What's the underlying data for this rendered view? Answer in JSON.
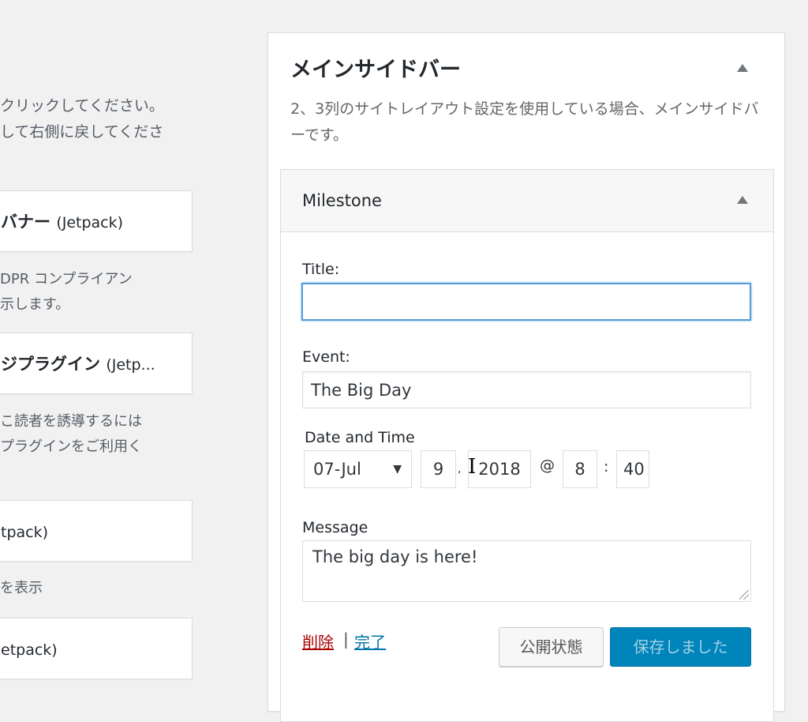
{
  "left_column": {
    "intro_lines": [
      "クリックしてください。",
      "して右側に戻してくださ"
    ],
    "widgets": [
      {
        "name": "バナー",
        "suffix": "(Jetpack)"
      },
      {
        "name": "ジプラグイン",
        "suffix": "(Jetp..."
      },
      {
        "name": "",
        "suffix": "tpack)"
      },
      {
        "name": "",
        "suffix": "etpack)"
      }
    ],
    "descriptions": [
      [
        "DPR コンプライアン",
        "示します。"
      ],
      [
        "こ読者を誘導するには",
        "プラグインをご利用く"
      ],
      [
        "を表示"
      ]
    ]
  },
  "sidebar": {
    "title": "メインサイドバー",
    "description": "2、3列のサイトレイアウト設定を使用している場合、メインサイドバーです。"
  },
  "widget": {
    "title": "Milestone",
    "fields": {
      "title_label": "Title:",
      "title_value": "",
      "event_label": "Event:",
      "event_value": "The Big Day",
      "datetime_label": "Date and Time",
      "month_value": "07-Jul",
      "day_value": "9",
      "comma": ",",
      "year_value": "2018",
      "at_sign": "@",
      "hour_value": "8",
      "colon": ":",
      "minute_value": "40",
      "message_label": "Message",
      "message_value": "The big day is here!"
    },
    "actions": {
      "delete_label": "削除",
      "separator": "|",
      "done_label": "完了",
      "visibility_label": "公開状態",
      "save_label": "保存しました"
    }
  },
  "colors": {
    "primary_button": "#0085ba",
    "focus_border": "#5b9dd9",
    "delete_link": "#aa0000",
    "done_link": "#0073aa"
  }
}
